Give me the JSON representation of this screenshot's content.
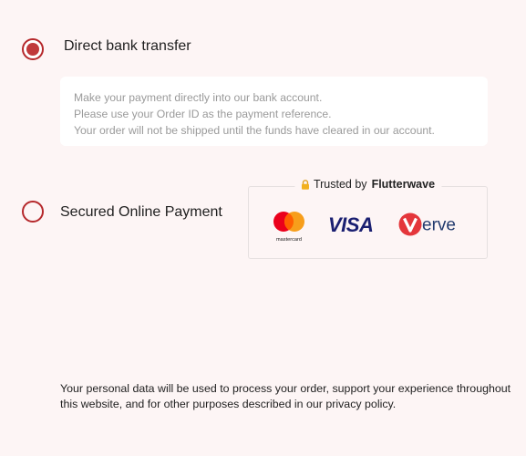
{
  "payment": {
    "direct_bank_transfer": {
      "label": "Direct bank transfer",
      "selected": true,
      "description": [
        "Make your payment directly into our bank account.",
        "Please use your Order ID as the payment reference.",
        "Your order will not be shipped until the funds have cleared in our account."
      ]
    },
    "online_payment": {
      "label": "Secured Online Payment",
      "selected": false,
      "trust_prefix": "Trusted by",
      "trust_brand": "Flutterwave",
      "logos": [
        "mastercard",
        "VISA",
        "erve"
      ]
    }
  },
  "privacy_notice": "Your personal data will be used to process your order, support your experience throughout this website, and for other purposes described in our privacy policy.",
  "colors": {
    "radio_accent": "#b5282b",
    "visa_blue": "#1a1f71",
    "verve_red": "#e4363b",
    "verve_navy": "#213a6e"
  }
}
